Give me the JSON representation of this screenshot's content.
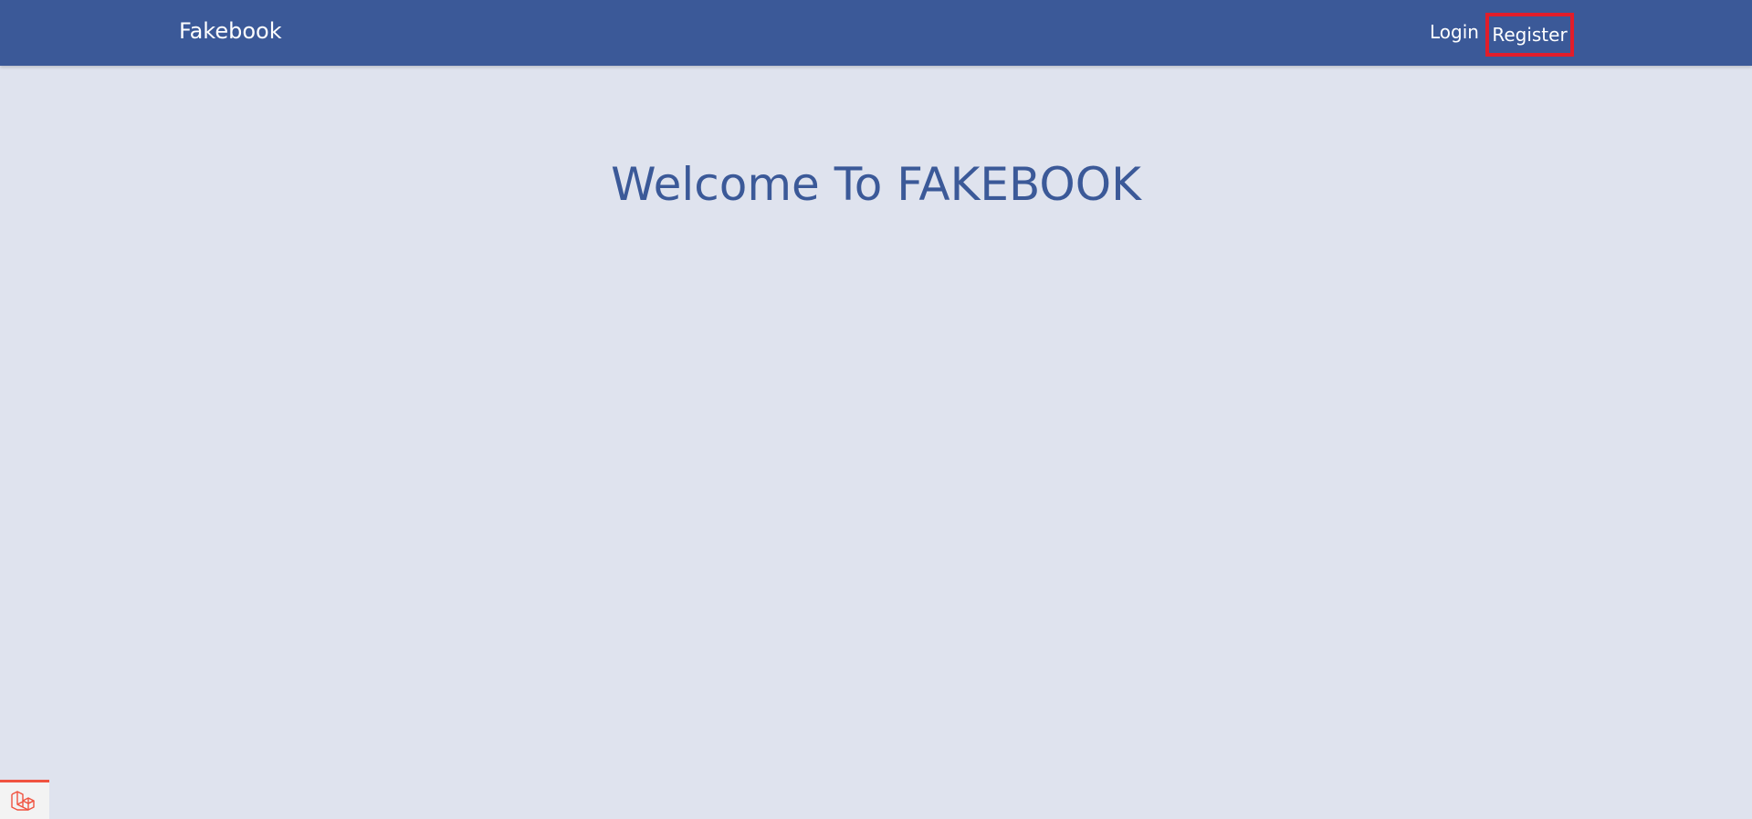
{
  "navbar": {
    "brand": "Fakebook",
    "links": {
      "login": "Login",
      "register": "Register"
    },
    "color": "#3b5998"
  },
  "main": {
    "welcome_heading": "Welcome To FAKEBOOK"
  },
  "debug_badge": {
    "icon": "laravel-logo-icon",
    "accent_color": "#f05340"
  },
  "colors": {
    "background": "#dfe3ee",
    "highlight_border": "#e11d2a"
  }
}
